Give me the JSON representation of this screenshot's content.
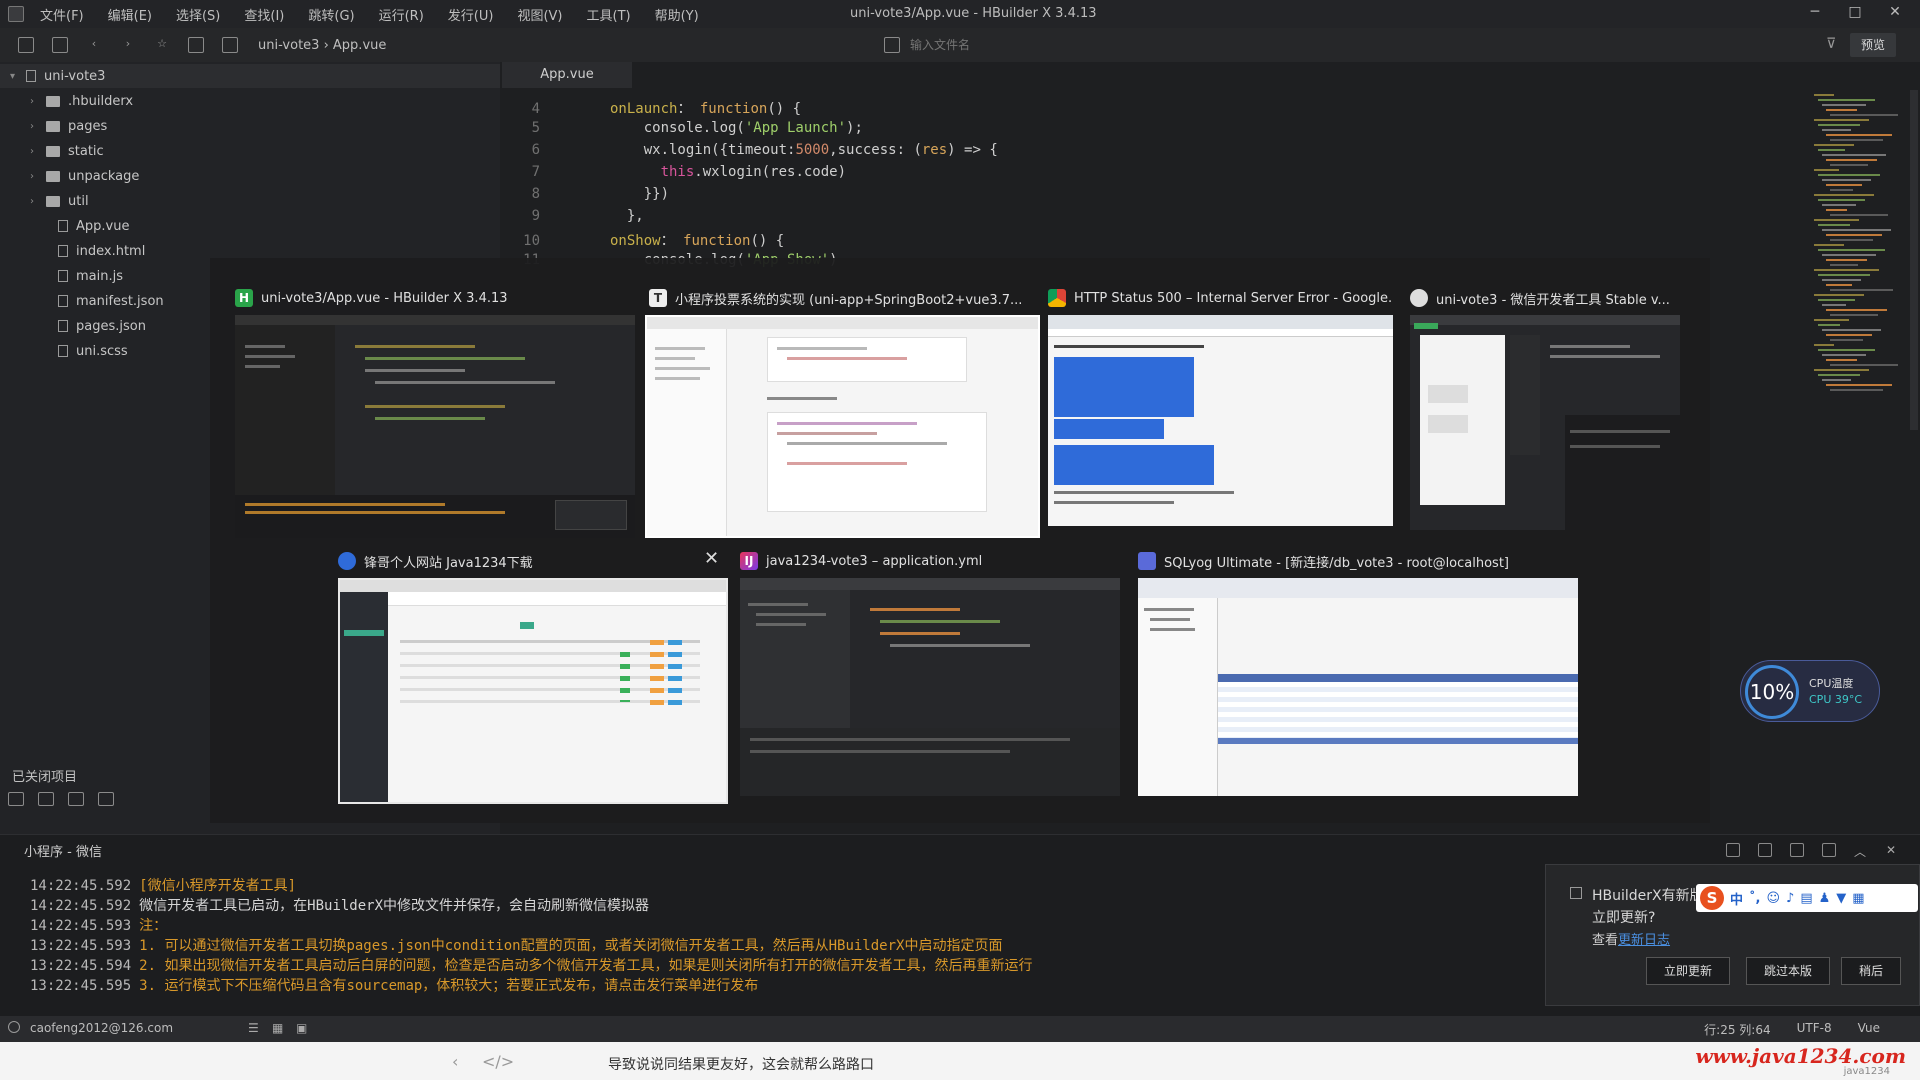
{
  "menubar": {
    "items": [
      "文件(F)",
      "编辑(E)",
      "选择(S)",
      "查找(I)",
      "跳转(G)",
      "运行(R)",
      "发行(U)",
      "视图(V)",
      "工具(T)",
      "帮助(Y)"
    ],
    "title": "uni-vote3/App.vue - HBuilder X 3.4.13"
  },
  "toolbar": {
    "breadcrumb": "uni-vote3 › App.vue",
    "input_placeholder": "输入文件名",
    "preview_label": "预览"
  },
  "sidebar": {
    "root": "uni-vote3",
    "items": [
      {
        "label": ".hbuilderx",
        "type": "folder"
      },
      {
        "label": "pages",
        "type": "folder"
      },
      {
        "label": "static",
        "type": "folder"
      },
      {
        "label": "unpackage",
        "type": "folder"
      },
      {
        "label": "util",
        "type": "folder"
      },
      {
        "label": "App.vue",
        "type": "file"
      },
      {
        "label": "index.html",
        "type": "file"
      },
      {
        "label": "main.js",
        "type": "file"
      },
      {
        "label": "manifest.json",
        "type": "file"
      },
      {
        "label": "pages.json",
        "type": "file"
      },
      {
        "label": "uni.scss",
        "type": "file"
      }
    ],
    "closed_projects": "已关闭项目"
  },
  "editor": {
    "tab": "App.vue",
    "lines": [
      {
        "n": "4",
        "parts": [
          [
            "kw",
            "onLaunch"
          ],
          [
            "",
            "： "
          ],
          [
            "fn",
            "function"
          ],
          [
            "",
            "() {"
          ]
        ]
      },
      {
        "n": "5",
        "parts": [
          [
            "",
            "    console.log("
          ],
          [
            "str",
            "'App Launch'"
          ],
          [
            "",
            ");"
          ]
        ]
      },
      {
        "n": "6",
        "parts": [
          [
            "",
            "    wx.login({timeout:"
          ],
          [
            "num",
            "5000"
          ],
          [
            "",
            ",success: ("
          ],
          [
            "fn",
            "res"
          ],
          [
            "",
            ") => {"
          ]
        ]
      },
      {
        "n": "7",
        "parts": [
          [
            "",
            "      "
          ],
          [
            "th",
            "this"
          ],
          [
            "",
            ".wxlogin(res.code)"
          ]
        ]
      },
      {
        "n": "8",
        "parts": [
          [
            "",
            "    }})"
          ]
        ]
      },
      {
        "n": "9",
        "parts": [
          [
            "",
            "  },"
          ]
        ]
      },
      {
        "n": "10",
        "parts": [
          [
            "kw",
            "onShow"
          ],
          [
            "",
            "： "
          ],
          [
            "fn",
            "function"
          ],
          [
            "",
            "() {"
          ]
        ]
      },
      {
        "n": "11",
        "parts": [
          [
            "",
            "    console.log("
          ],
          [
            "str",
            "'App Show'"
          ],
          [
            "",
            ")"
          ]
        ]
      }
    ]
  },
  "switcher": {
    "windows": [
      {
        "title": "uni-vote3/App.vue - HBuilder X 3.4.13",
        "icon": "H"
      },
      {
        "title": "小程序投票系统的实现 (uni-app+SpringBoot2+vue3.7...",
        "icon": "T"
      },
      {
        "title": "HTTP Status 500 – Internal Server Error - Google...",
        "icon": ""
      },
      {
        "title": "uni-vote3 - 微信开发者工具 Stable v...",
        "icon": ""
      },
      {
        "title": "锋哥个人网站 Java1234下载",
        "icon": ""
      },
      {
        "title": "java1234-vote3 – application.yml",
        "icon": "IJ"
      },
      {
        "title": "SQLyog Ultimate - [新连接/db_vote3 - root@localhost]",
        "icon": ""
      }
    ]
  },
  "console": {
    "title": "小程序 - 微信",
    "lines": [
      {
        "ts": "14:22:45.592",
        "text": "[微信小程序开发者工具]",
        "color": "orange"
      },
      {
        "ts": "14:22:45.592",
        "text": "微信开发者工具已启动，在HBuilderX中修改文件并保存，会自动刷新微信模拟器",
        "color": "white"
      },
      {
        "ts": "14:22:45.593",
        "text": "注：",
        "color": "orange"
      },
      {
        "ts": "13:22:45.593",
        "text": "1. 可以通过微信开发者工具切换pages.json中condition配置的页面，或者关闭微信开发者工具，然后再从HBuilderX中启动指定页面",
        "color": "orange"
      },
      {
        "ts": "13:22:45.594",
        "text": "2. 如果出现微信开发者工具启动后白屏的问题，检查是否启动多个微信开发者工具，如果是则关闭所有打开的微信开发者工具，然后再重新运行",
        "color": "orange"
      },
      {
        "ts": "13:22:45.595",
        "text": "3. 运行模式下不压缩代码且含有sourcemap，体积较大；若要正式发布，请点击发行菜单进行发布",
        "color": "orange"
      }
    ]
  },
  "statusbar": {
    "user": "caofeng2012@126.com",
    "position": "行:25  列:64",
    "encoding": "UTF-8",
    "lang": "Vue"
  },
  "update": {
    "title": "HBuilderX有新版",
    "question": "立即更新?",
    "link_prefix": "查看",
    "link": "更新日志",
    "buttons": [
      "立即更新",
      "跳过本版",
      "稍后"
    ]
  },
  "cpu": {
    "percent": "10%",
    "label": "CPU温度",
    "temp": "CPU 39°C"
  },
  "bottom": {
    "text": "导致说说同结果更友好，这会就帮么路路口",
    "watermark": "www.java1234.com",
    "watermark_sub": "java1234"
  }
}
